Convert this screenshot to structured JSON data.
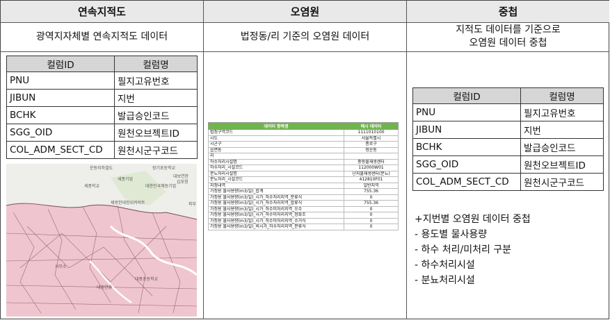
{
  "headers": [
    "연속지적도",
    "오염원",
    "중첩"
  ],
  "subtitles": {
    "col1": "광역지자체별 연속지적도 데이터",
    "col2": "법정동/리 기준의 오염원 데이터",
    "col3_line1": "지적도 데이터를 기준으로",
    "col3_line2": "오염원 데이터 중첩"
  },
  "column_table": {
    "header": [
      "컬럼ID",
      "컬럼명"
    ],
    "rows": [
      [
        "PNU",
        "필지고유번호"
      ],
      [
        "JIBUN",
        "지번"
      ],
      [
        "BCHK",
        "발급승인코드"
      ],
      [
        "SGG_OID",
        "원천오브젝트ID"
      ],
      [
        "COL_ADM_SECT_CD",
        "원천시군구코드"
      ]
    ]
  },
  "map_labels": [
    "운동지하철도",
    "장기초등학교",
    "세중학교",
    "세종기업",
    "대한민국해동기업",
    "대보연한",
    "김포청",
    "제방한데항위커비트",
    "피부",
    "사무소",
    "대중연화",
    "대중초등학교"
  ],
  "pollution_table": {
    "header": [
      "데이터 항목명",
      "예시 데이터"
    ],
    "rows": [
      [
        "법정구역코드",
        "1111010100"
      ],
      [
        "시도",
        "서울특별시"
      ],
      [
        "시군구",
        "종로구"
      ],
      [
        "읍면동",
        "청운동"
      ],
      [
        "리",
        ""
      ],
      [
        "하수처리시설명",
        "중랑물재생센터"
      ],
      [
        "하수처리_시설코드",
        "112000W01"
      ],
      [
        "분뇨처리시설명",
        "난지물재생센터(분뇨)"
      ],
      [
        "분뇨처리_시설코드",
        "412810F01"
      ],
      [
        "지정내역",
        "일반지역"
      ],
      [
        "가정용 물사용량(m3/일)_합계",
        "755.36"
      ],
      [
        "가정용 물사용량(m3/일)_시가_하수처리지역_분류식",
        "0"
      ],
      [
        "가정용 물사용량(m3/일)_시가_하수처리지역_합류식",
        "755.36"
      ],
      [
        "가정용 물사용량(m3/일)_시가_하수미처리지역_오수",
        "0"
      ],
      [
        "가정용 물사용량(m3/일)_시가_하수미처리지역_정화조",
        "0"
      ],
      [
        "가정용 물사용량(m3/일)_시가_하수미처리지역_수거식",
        "0"
      ],
      [
        "가정용 물사용량(m3/일)_비시가_하수처리지역_분류식",
        "0"
      ]
    ]
  },
  "overlay_notes": [
    "+지번별 오염원 데이터 중첩",
    "- 용도별 물사용량",
    "- 하수 처리/미처리 구분",
    "- 하수처리시설",
    "- 분뇨처리시설"
  ]
}
